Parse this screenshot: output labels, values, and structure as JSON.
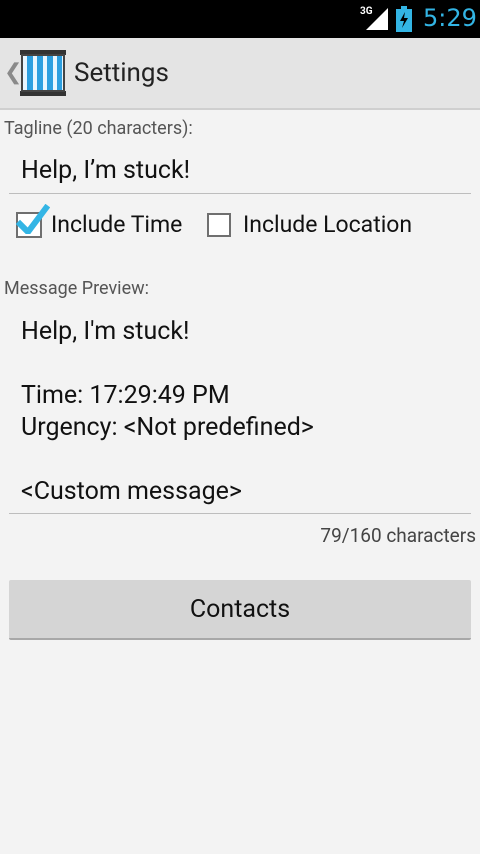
{
  "statusbar": {
    "network": "3G",
    "time": "5:29"
  },
  "actionbar": {
    "title": "Settings",
    "up_glyph": "❮"
  },
  "tagline": {
    "label": "Tagline (20 characters):",
    "value": "Help, I’m stuck!"
  },
  "options": {
    "include_time": {
      "label": "Include Time",
      "checked": true
    },
    "include_location": {
      "label": "Include Location",
      "checked": false
    }
  },
  "preview": {
    "label": "Message Preview:",
    "lines": [
      "Help, I'm stuck!",
      "",
      "Time: 17:29:49 PM",
      "Urgency: <Not predefined>",
      "",
      "<Custom message>"
    ],
    "counter": "79/160 characters"
  },
  "contacts_button": {
    "label": "Contacts"
  },
  "colors": {
    "accent": "#33b5e5",
    "background": "#f3f3f3",
    "actionbar": "#e4e4e4"
  },
  "icons": [
    "signal-icon",
    "battery-icon",
    "app-icon",
    "checkmark-icon"
  ]
}
